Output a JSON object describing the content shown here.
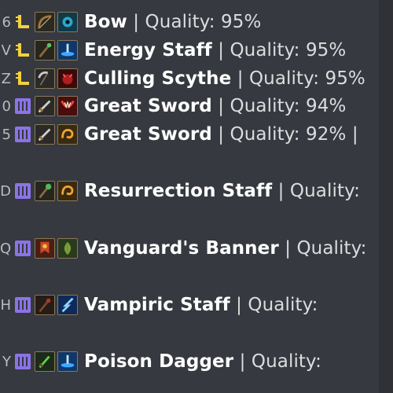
{
  "rows": [
    {
      "prefix": "6",
      "rank": "legendary",
      "icon1": "bow-icon",
      "icon2": "eye-icon",
      "name": "Bow",
      "rest": " | Quality: 95%"
    },
    {
      "prefix": "V",
      "rank": "legendary",
      "icon1": "staff-icon",
      "icon2": "energy-icon",
      "name": "Energy Staff",
      "rest": " | Quality: 95%"
    },
    {
      "prefix": "Z",
      "rank": "legendary",
      "icon1": "scythe-icon",
      "icon2": "demon-icon",
      "name": "Culling Scythe",
      "rest": " | Quality: 95%"
    },
    {
      "prefix": "0",
      "rank": "epic",
      "icon1": "sword-icon",
      "icon2": "fang-icon",
      "name": "Great Sword",
      "rest": " | Quality: 94%"
    },
    {
      "prefix": "5",
      "rank": "epic",
      "icon1": "sword-icon",
      "icon2": "swirl-icon",
      "name": "Great Sword",
      "rest": " | Quality: 92% |"
    },
    {
      "prefix": "D",
      "rank": "epic",
      "icon1": "staff-icon",
      "icon2": "swirl-icon",
      "name": "Resurrection Staff",
      "rest": " | Quality:"
    },
    {
      "prefix": "Q",
      "rank": "epic",
      "icon1": "banner-icon",
      "icon2": "leaf-icon",
      "name": "Vanguard's Banner",
      "rest": " | Quality:"
    },
    {
      "prefix": "H",
      "rank": "epic",
      "icon1": "staff-icon",
      "icon2": "lightning-icon",
      "name": "Vampiric Staff",
      "rest": " | Quality:"
    },
    {
      "prefix": "Y",
      "rank": "epic",
      "icon1": "dagger-icon",
      "icon2": "energy-icon",
      "name": "Poison Dagger",
      "rest": " | Quality:"
    }
  ],
  "colors": {
    "legendary": "#f2d13d",
    "epic": "#8b73e8",
    "background": "#36393f"
  }
}
